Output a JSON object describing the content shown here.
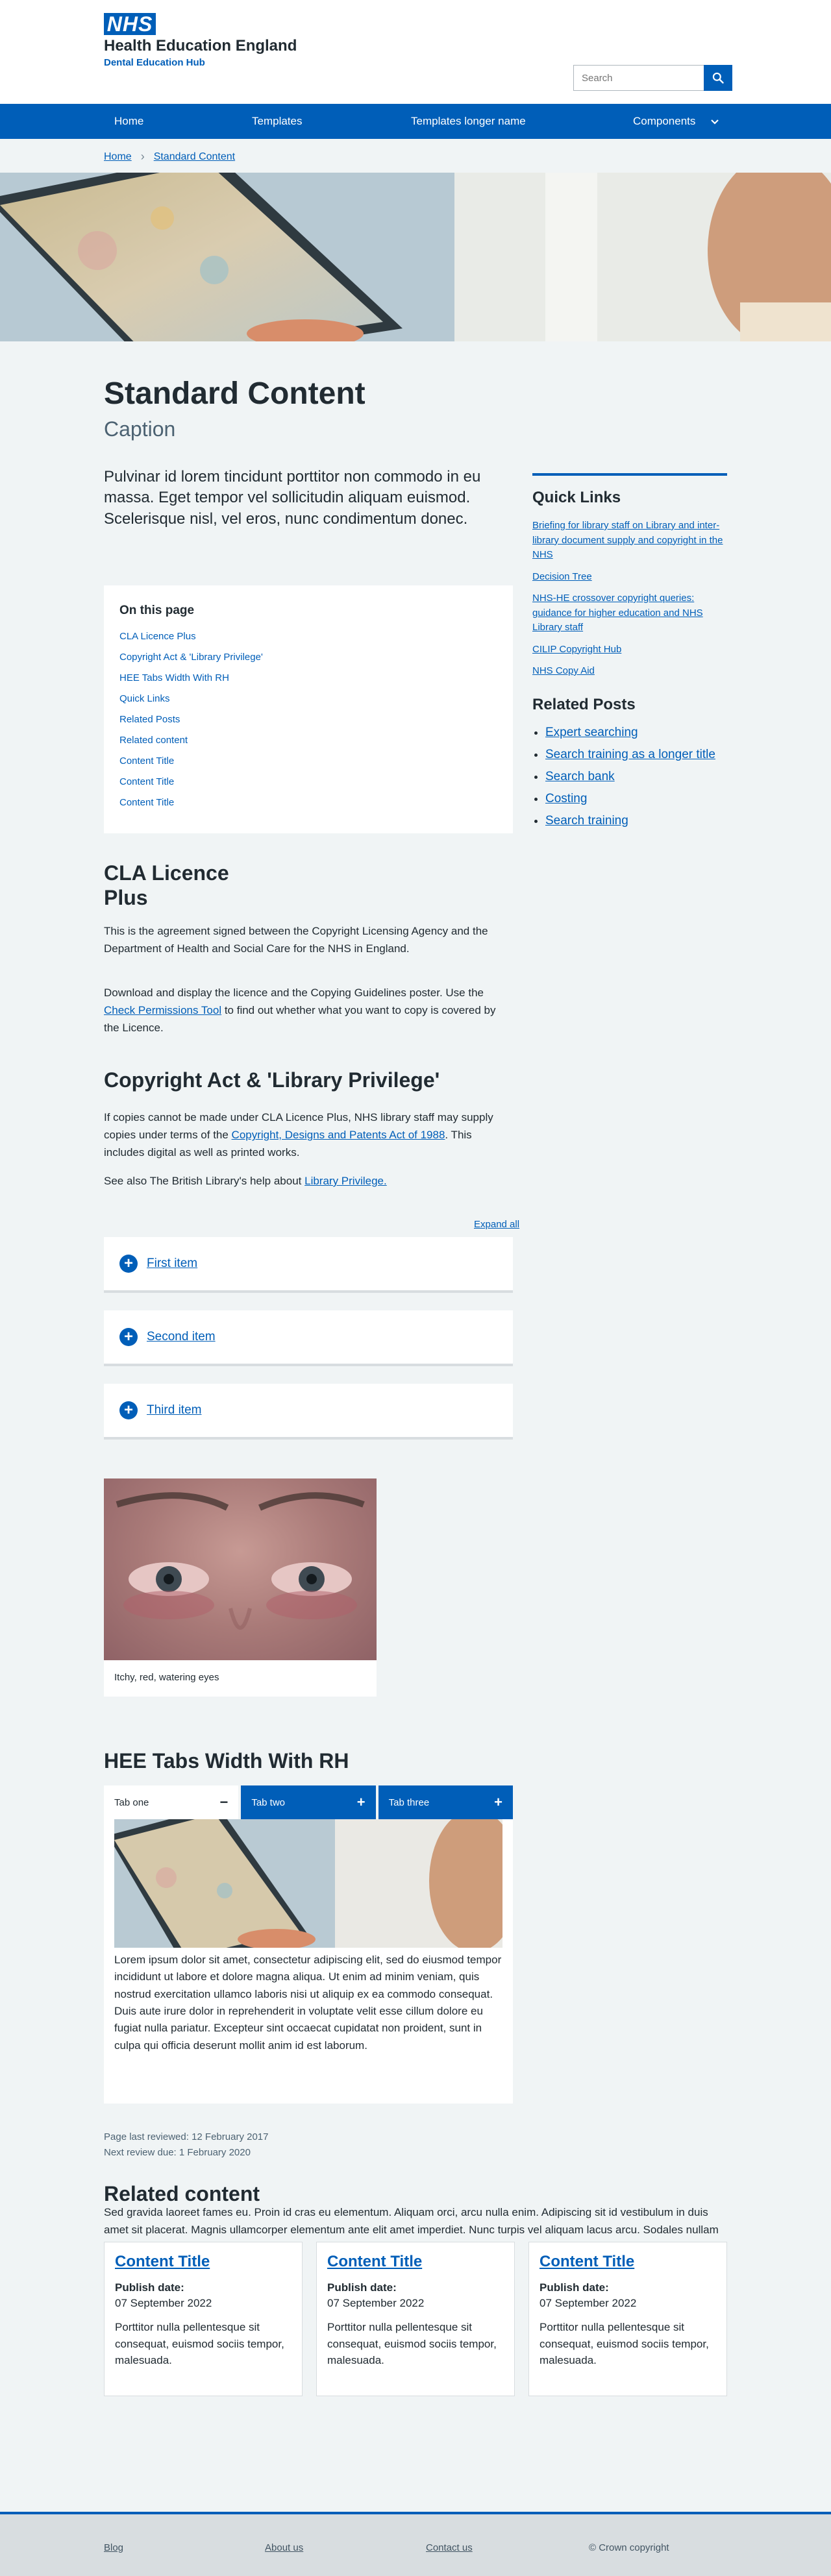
{
  "header": {
    "logo_text": "NHS",
    "org_name": "Health Education England",
    "sub_name": "Dental Education Hub",
    "search_placeholder": "Search"
  },
  "nav": {
    "items": [
      "Home",
      "Templates",
      "Templates longer name",
      "Components"
    ]
  },
  "breadcrumb": [
    "Home",
    "Standard Content"
  ],
  "page": {
    "title": "Standard Content",
    "caption": "Caption",
    "lede": "Pulvinar id lorem tincidunt porttitor non commodo in eu massa. Eget tempor vel sollicitudin aliquam euismod. Scelerisque nisl, vel eros, nunc condimentum donec."
  },
  "on_this_page": {
    "heading": "On this page",
    "links": [
      "CLA Licence Plus",
      "Copyright Act & 'Library Privilege'",
      "HEE Tabs Width With RH",
      "Quick Links",
      "Related Posts",
      "Related content",
      "Content Title",
      "Content Title",
      "Content Title"
    ]
  },
  "cla": {
    "heading_line1": "CLA Licence",
    "heading_line2": "Plus",
    "p1": "This is the agreement signed between the Copyright Licensing Agency and the Department of Health and Social Care for the NHS in England.",
    "p2_before": "Download and display the licence and the Copying Guidelines poster. Use the ",
    "p2_link": "Check Permissions Tool",
    "p2_after": " to find out whether what you want to copy is covered by the Licence."
  },
  "copyright": {
    "heading": "Copyright Act & 'Library Privilege'",
    "p1_before": "If copies cannot be made under CLA Licence Plus, NHS library staff may supply copies under terms of the ",
    "p1_link": "Copyright, Designs and Patents Act of 1988",
    "p1_after": ". This includes digital as well as printed works.",
    "p2_before": "See also The British Library's help about ",
    "p2_link": "Library Privilege."
  },
  "accordion": {
    "expand_all": "Expand all",
    "items": [
      "First item",
      "Second item",
      "Third item"
    ]
  },
  "image_card": {
    "caption": "Itchy, red, watering eyes"
  },
  "tabs": {
    "heading": "HEE Tabs Width With RH",
    "items": [
      {
        "label": "Tab one",
        "symbol": "−"
      },
      {
        "label": "Tab two",
        "symbol": "+"
      },
      {
        "label": "Tab three",
        "symbol": "+"
      }
    ],
    "panel_text": "Lorem ipsum dolor sit amet, consectetur adipiscing elit, sed do eiusmod tempor incididunt ut labore et dolore magna aliqua. Ut enim ad minim veniam, quis nostrud exercitation ullamco laboris nisi ut aliquip ex ea commodo consequat. Duis aute irure dolor in reprehenderit in voluptate velit esse cillum dolore eu fugiat nulla pariatur. Excepteur sint occaecat cupidatat non proident, sunt in culpa qui officia deserunt mollit anim id est laborum."
  },
  "review": {
    "last_reviewed": "Page last reviewed: 12 February 2017",
    "next_review": "Next review due: 1 February 2020"
  },
  "related_content": {
    "heading": "Related content",
    "intro": "Sed gravida laoreet fames eu. Proin id cras eu elementum. Aliquam orci, arcu nulla enim. Adipiscing sit id vestibulum in duis amet sit placerat. Magnis ullamcorper elementum ante elit amet imperdiet. Nunc turpis vel aliquam lacus arcu. Sodales nullam id lectus orci quis sed. dsf",
    "cards": [
      {
        "title": "Content Title",
        "date_label": "Publish date:",
        "date": "07 September 2022",
        "text": "Porttitor nulla pellentesque sit consequat, euismod sociis tempor, malesuada."
      },
      {
        "title": "Content Title",
        "date_label": "Publish date:",
        "date": "07 September 2022",
        "text": "Porttitor nulla pellentesque sit consequat, euismod sociis tempor, malesuada."
      },
      {
        "title": "Content Title",
        "date_label": "Publish date:",
        "date": "07 September 2022",
        "text": "Porttitor nulla pellentesque sit consequat, euismod sociis tempor, malesuada."
      }
    ]
  },
  "sidebar": {
    "quick_links_heading": "Quick Links",
    "quick_links": [
      "Briefing for library staff on Library and inter-library document supply and copyright in the NHS",
      "Decision Tree",
      "NHS-HE crossover copyright queries: guidance for higher education and NHS Library staff",
      "CILIP Copyright Hub",
      "NHS Copy Aid"
    ],
    "related_posts_heading": "Related Posts",
    "related_posts": [
      "Expert searching",
      "Search training as a longer title",
      "Search bank",
      "Costing",
      "Search training"
    ]
  },
  "footer": {
    "links": [
      "Blog",
      "About us",
      "Contact us"
    ],
    "copyright": "© Crown copyright"
  },
  "colors": {
    "brand_blue": "#005eb8",
    "page_bg": "#f0f4f5",
    "text": "#212b32",
    "secondary_text": "#4c6272"
  }
}
